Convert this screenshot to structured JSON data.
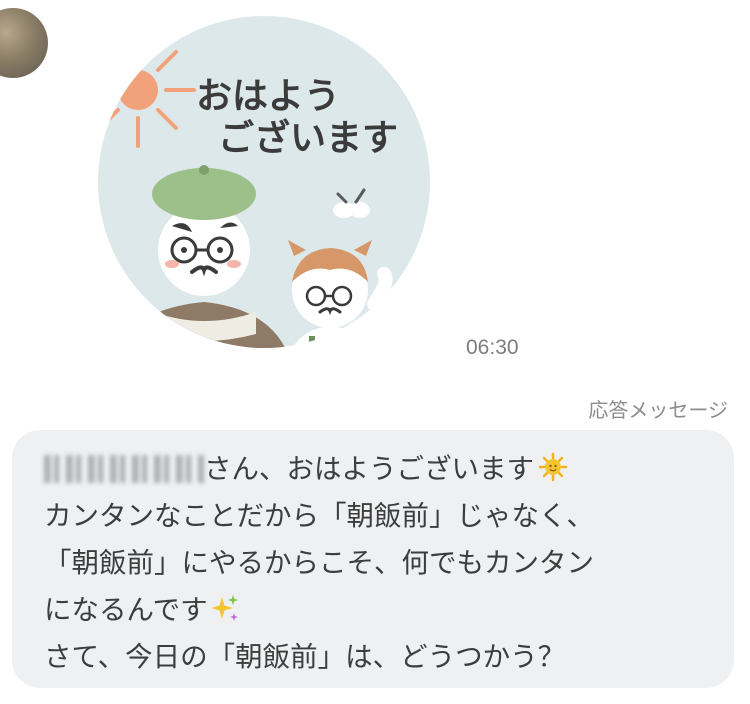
{
  "chat": {
    "sticker_text_line1": "おはよう",
    "sticker_text_line2": "ございます",
    "timestamp": "06:30",
    "auto_reply_label": "応答メッセージ",
    "message": {
      "line1_suffix": "さん、おはようございます",
      "line2": "カンタンなことだから「朝飯前」じゃなく、",
      "line3": "「朝飯前」にやるからこそ、何でもカンタン",
      "line4": "になるんです",
      "line5": "さて、今日の「朝飯前」は、どうつかう？"
    }
  },
  "colors": {
    "bubble": "#eef0f2",
    "sticker_circle": "#dde8ea",
    "sun": "#f2a27a",
    "beret": "#9dbf8a"
  },
  "icons": [
    "avatar",
    "sun-emoji-icon",
    "sparkles-emoji-icon"
  ]
}
